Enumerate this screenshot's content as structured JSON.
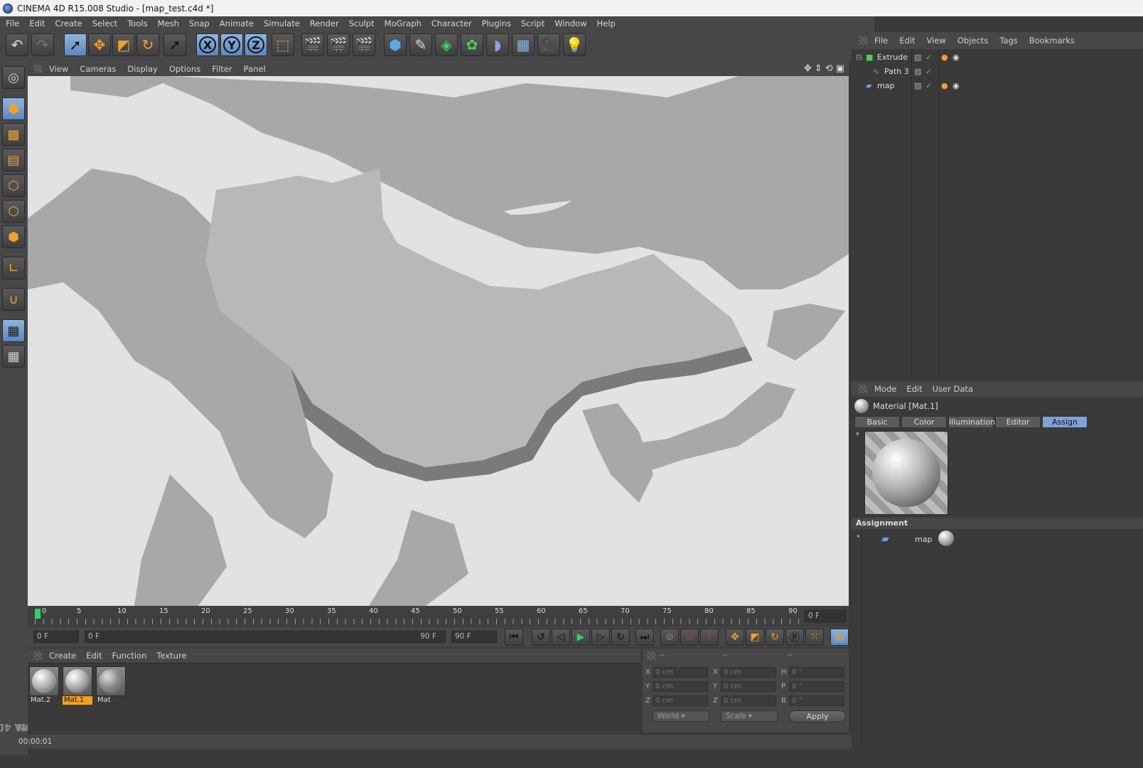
{
  "window": {
    "title": "CINEMA 4D R15.008 Studio - [map_test.c4d *]"
  },
  "menubar": [
    "File",
    "Edit",
    "Create",
    "Select",
    "Tools",
    "Mesh",
    "Snap",
    "Animate",
    "Simulate",
    "Render",
    "Sculpt",
    "MoGraph",
    "Character",
    "Plugins",
    "Script",
    "Window",
    "Help"
  ],
  "toolbar": {
    "icons": [
      "undo-icon",
      "redo-icon",
      "live-select-icon",
      "move-icon",
      "scale-icon",
      "rotate-icon",
      "recent-tool-icon",
      "x-axis-icon",
      "y-axis-icon",
      "z-axis-icon",
      "coordinate-system-icon",
      "render-view-icon",
      "render-picture-viewer-icon",
      "edit-render-settings-icon",
      "cube-icon",
      "spline-pen-icon",
      "subdivision-icon",
      "cloner-icon",
      "deformer-icon",
      "floor-icon",
      "camera-icon",
      "light-icon"
    ],
    "axis_labels": [
      "X",
      "Y",
      "Z"
    ]
  },
  "viewport": {
    "menu": [
      "View",
      "Cameras",
      "Display",
      "Options",
      "Filter",
      "Panel"
    ]
  },
  "timeline": {
    "ticks": [
      "0",
      "5",
      "10",
      "15",
      "20",
      "25",
      "30",
      "35",
      "40",
      "45",
      "50",
      "55",
      "60",
      "65",
      "70",
      "75",
      "80",
      "85",
      "90"
    ],
    "current_frame": "0 F",
    "start_field": "0 F",
    "range_start": "0 F",
    "range_end": "90 F",
    "end_field": "90 F"
  },
  "material_manager": {
    "menu": [
      "Create",
      "Edit",
      "Function",
      "Texture"
    ],
    "materials": [
      {
        "name": "Mat.2",
        "selected": false
      },
      {
        "name": "Mat.1",
        "selected": true
      },
      {
        "name": "Mat",
        "selected": false
      }
    ]
  },
  "coordinates": {
    "header": [
      "--",
      "--",
      "--"
    ],
    "rows": [
      {
        "l1": "X",
        "v1": "0 cm",
        "l2": "X",
        "v2": "0 cm",
        "l3": "H",
        "v3": "0 °"
      },
      {
        "l1": "Y",
        "v1": "0 cm",
        "l2": "Y",
        "v2": "0 cm",
        "l3": "P",
        "v3": "0 °"
      },
      {
        "l1": "Z",
        "v1": "0 cm",
        "l2": "Z",
        "v2": "0 cm",
        "l3": "B",
        "v3": "0 °"
      }
    ],
    "mode_select": "World",
    "size_select": "Scale",
    "apply_label": "Apply"
  },
  "object_manager": {
    "menu": [
      "File",
      "Edit",
      "View",
      "Objects",
      "Tags",
      "Bookmarks"
    ],
    "objects": [
      {
        "name": "Extrude",
        "depth": 0
      },
      {
        "name": "Path 3",
        "depth": 1
      },
      {
        "name": "map",
        "depth": 0
      }
    ]
  },
  "attribute_manager": {
    "menu": [
      "Mode",
      "Edit",
      "User Data"
    ],
    "title": "Material [Mat.1]",
    "tabs": [
      "Basic",
      "Color",
      "Illumination",
      "Editor",
      "Assign"
    ],
    "active_tab": "Assign",
    "section": "Assignment",
    "assigned_object": "map"
  },
  "status": {
    "text": "00:00:01"
  },
  "brand": {
    "line1": "MAXON",
    "line2": "CINEMA 4D"
  },
  "colors": {
    "accent": "#7da2d6",
    "selected_material": "#f0a020",
    "panel": "#474747",
    "background": "#3a3a3a"
  }
}
